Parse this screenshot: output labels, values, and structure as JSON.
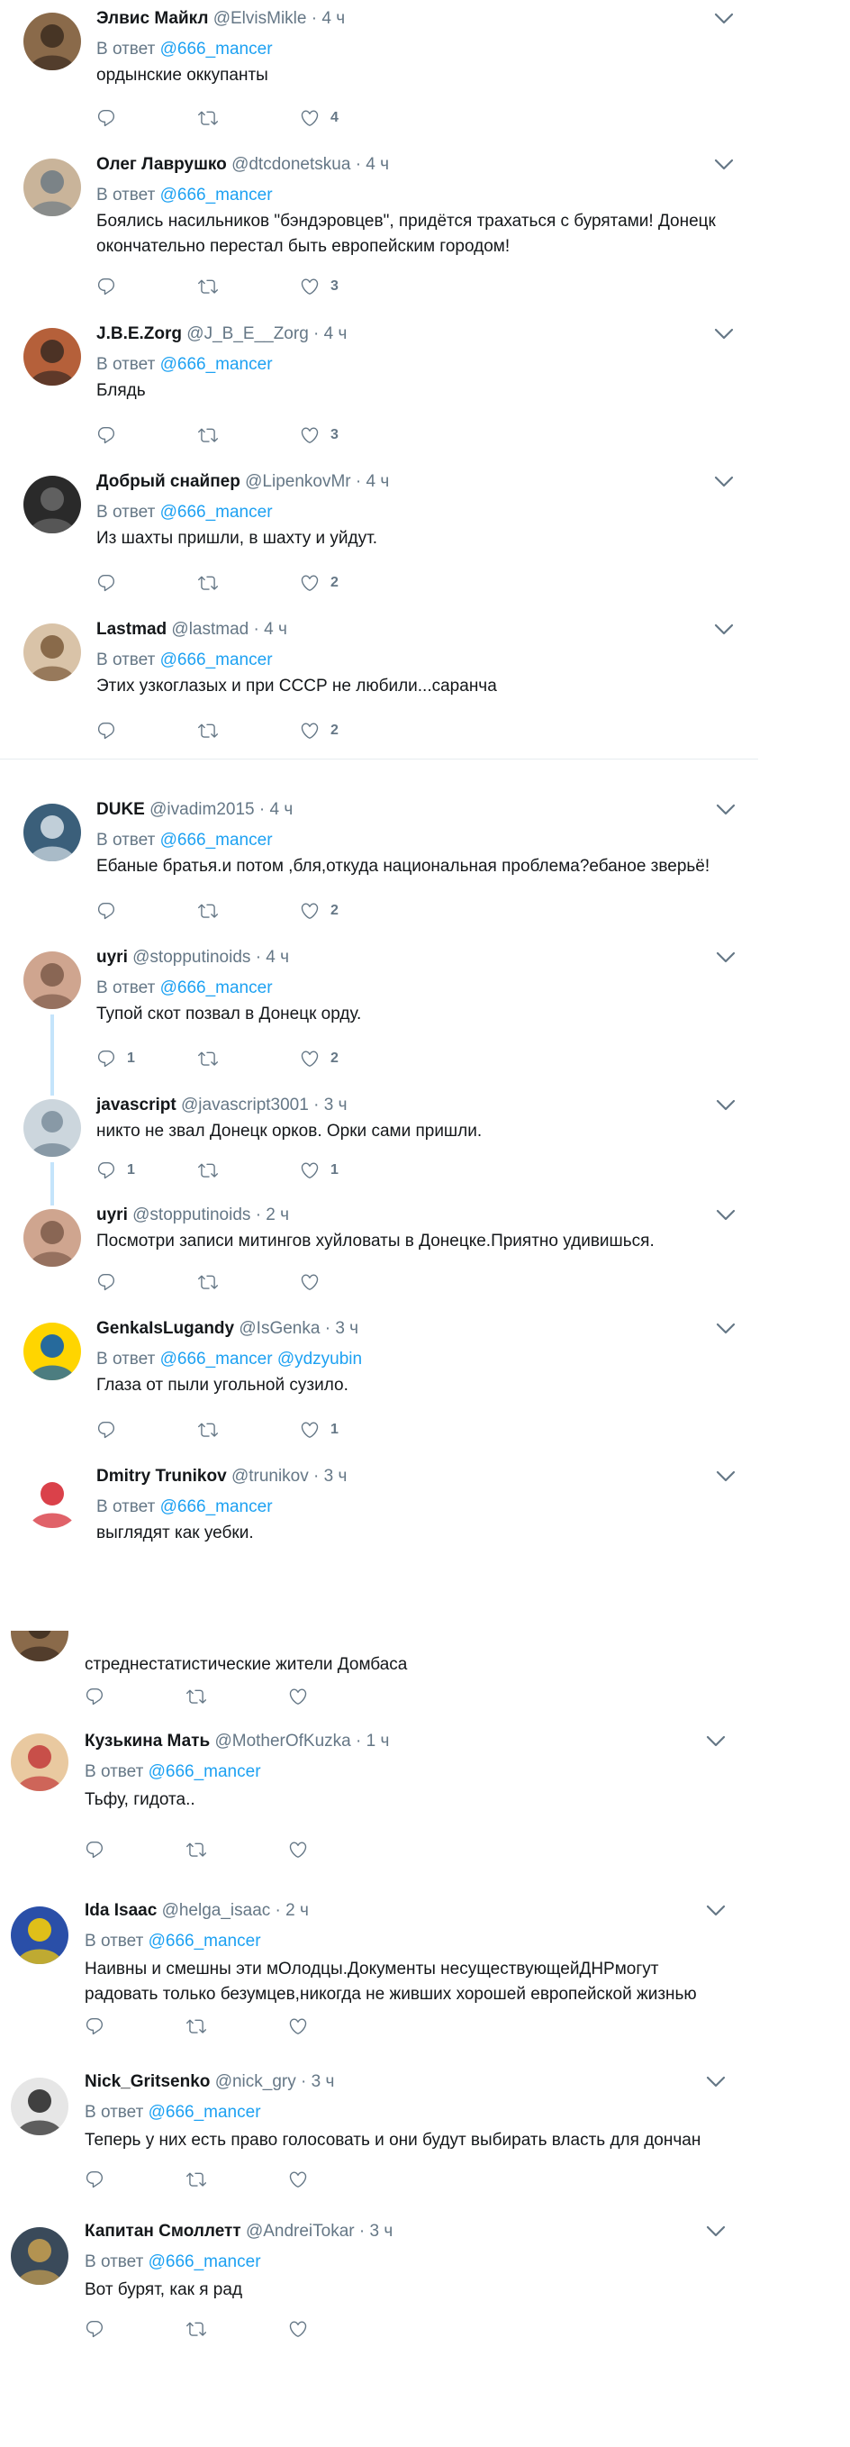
{
  "reply_prefix": "В ответ",
  "dot": "·",
  "section1": [
    {
      "name": "Элвис Майкл",
      "handle": "@ElvisMikle",
      "time": "4 ч",
      "reply_to": [
        "@666_mancer"
      ],
      "text": "ордынские оккупанты",
      "replies": "",
      "retweets": "",
      "likes": "4"
    },
    {
      "name": "Олег Лаврушко",
      "handle": "@dtcdonetskua",
      "time": "4 ч",
      "reply_to": [
        "@666_mancer"
      ],
      "text": "Боялись насильников \"бэндэровцев\", придётся трахаться с бурятами! Донецк окончательно перестал быть европейским городом!",
      "replies": "",
      "retweets": "",
      "likes": "3"
    },
    {
      "name": "J.B.E.Zorg",
      "handle": "@J_B_E__Zorg",
      "time": "4 ч",
      "reply_to": [
        "@666_mancer"
      ],
      "text": "Блядь",
      "replies": "",
      "retweets": "",
      "likes": "3"
    },
    {
      "name": "Добрый снайпер",
      "handle": "@LipenkovMr",
      "time": "4 ч",
      "reply_to": [
        "@666_mancer"
      ],
      "text": "Из шахты пришли, в шахту и уйдут.",
      "replies": "",
      "retweets": "",
      "likes": "2"
    },
    {
      "name": "Lastmad",
      "handle": "@lastmad",
      "time": "4 ч",
      "reply_to": [
        "@666_mancer"
      ],
      "text": "Этих узкоглазых и при СССР не любили...саранча",
      "replies": "",
      "retweets": "",
      "likes": "2"
    }
  ],
  "section2": [
    {
      "name": "DUKE",
      "handle": "@ivadim2015",
      "time": "4 ч",
      "reply_to": [
        "@666_mancer"
      ],
      "text": "Ебаные братья.и потом ,бля,откуда национальная проблема?ебаное зверьё!",
      "replies": "",
      "retweets": "",
      "likes": "2"
    },
    {
      "name": "uyri",
      "handle": "@stopputinoids",
      "time": "4 ч",
      "reply_to": [
        "@666_mancer"
      ],
      "text": "Тупой скот позвал в Донецк орду.",
      "replies": "1",
      "retweets": "",
      "likes": "2"
    },
    {
      "name": "javascript",
      "handle": "@javascript3001",
      "time": "3 ч",
      "reply_to": [],
      "text": "никто не звал Донецк орков. Орки сами пришли.",
      "replies": "1",
      "retweets": "",
      "likes": "1"
    },
    {
      "name": "uyri",
      "handle": "@stopputinoids",
      "time": "2 ч",
      "reply_to": [],
      "text": "Посмотри записи митингов хуйловаты в Донецке.Приятно удивишься.",
      "replies": "",
      "retweets": "",
      "likes": ""
    },
    {
      "name": "GenkaIsLugandy",
      "handle": "@IsGenka",
      "time": "3 ч",
      "reply_to": [
        "@666_mancer",
        "@ydzyubin"
      ],
      "text": "Глаза от пыли угольной сузило.",
      "replies": "",
      "retweets": "",
      "likes": "1"
    },
    {
      "name": "Dmitry Trunikov",
      "handle": "@trunikov",
      "time": "3 ч",
      "reply_to": [
        "@666_mancer"
      ],
      "text": "выглядят как уебки.",
      "replies": "",
      "retweets": "",
      "likes": ""
    }
  ],
  "section3": [
    {
      "name": "",
      "handle": "",
      "time": "",
      "reply_to": [],
      "text": "стреднестатистические жители Домбаса",
      "replies": "",
      "retweets": "",
      "likes": ""
    },
    {
      "name": "Кузькина Мать",
      "handle": "@MotherOfKuzka",
      "time": "1 ч",
      "reply_to": [
        "@666_mancer"
      ],
      "text": "Тьфу, гидота..",
      "replies": "",
      "retweets": "",
      "likes": ""
    },
    {
      "name": "Ida Isaac",
      "handle": "@helga_isaac",
      "time": "2 ч",
      "reply_to": [
        "@666_mancer"
      ],
      "text": "Наивны и смешны эти мОлодцы.Документы несуществующейДНРмогут радовать только безумцев,никогда не живших хорошей европейской жизнью",
      "replies": "",
      "retweets": "",
      "likes": ""
    },
    {
      "name": "Nick_Gritsenko",
      "handle": "@nick_gry",
      "time": "3 ч",
      "reply_to": [
        "@666_mancer"
      ],
      "text": "Теперь у них есть право голосовать и они будут выбирать власть для дончан",
      "replies": "",
      "retweets": "",
      "likes": ""
    },
    {
      "name": "Капитан Смоллетт",
      "handle": "@AndreiTokar",
      "time": "3 ч",
      "reply_to": [
        "@666_mancer"
      ],
      "text": "Вот бурят, как я рад",
      "replies": "",
      "retweets": "",
      "likes": ""
    }
  ]
}
